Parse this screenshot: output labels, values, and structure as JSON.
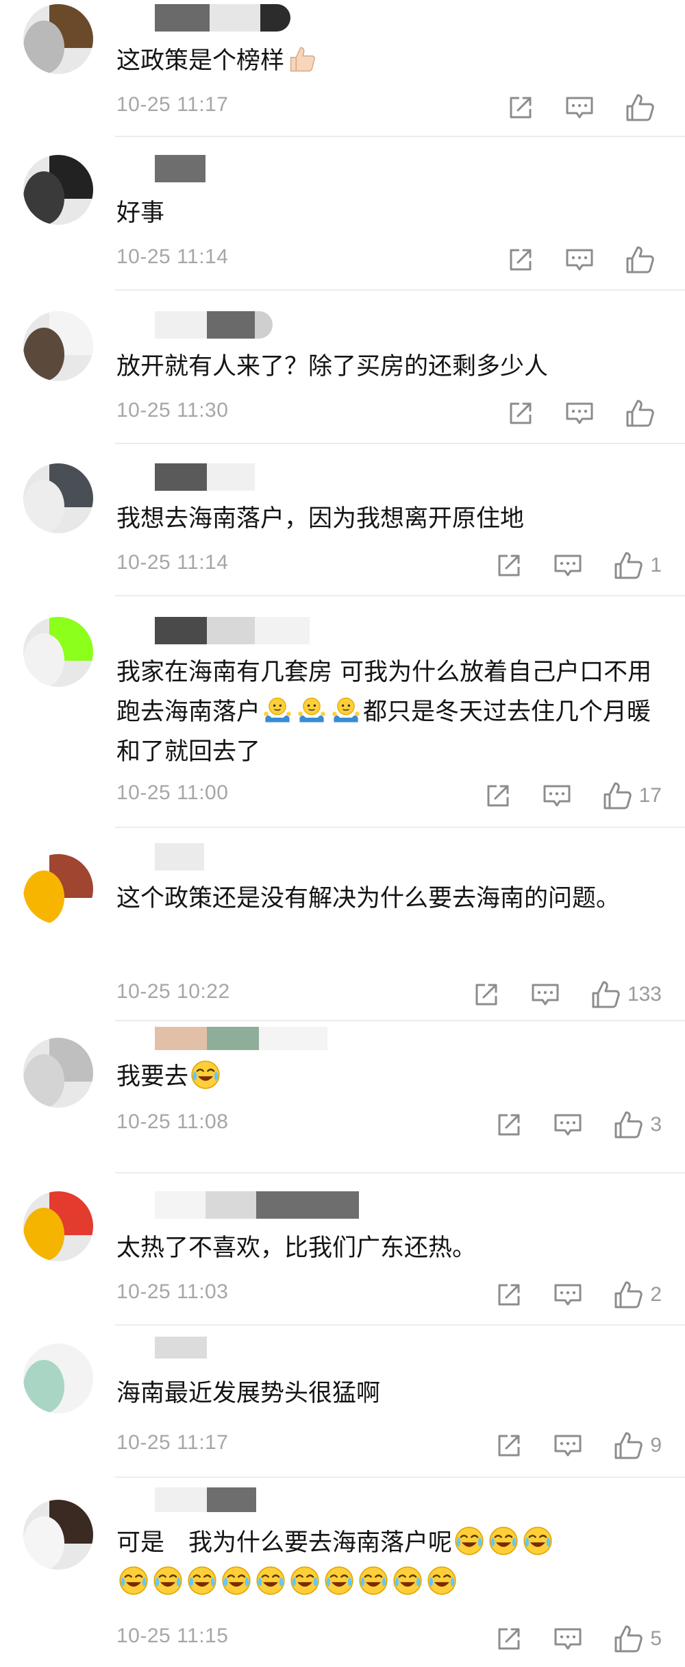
{
  "comments": [
    {
      "text": "这政策是个榜样",
      "time": "10-25 11:17",
      "likes": ""
    },
    {
      "text": "好事",
      "time": "10-25 11:14",
      "likes": ""
    },
    {
      "text": "放开就有人来了？除了买房的还剩多少人",
      "time": "10-25 11:30",
      "likes": ""
    },
    {
      "text": "我想去海南落户，因为我想离开原住地",
      "time": "10-25 11:14",
      "likes": "1"
    },
    {
      "text_a": "我家在海南有几套房 可我为什么放着自己户口不用跑去海南落户",
      "text_b": "都只是冬天过去住几个月暖和了就回去了",
      "time": "10-25 11:00",
      "likes": "17"
    },
    {
      "text": "这个政策还是没有解决为什么要去海南的问题。",
      "time": "10-25 10:22",
      "likes": "133"
    },
    {
      "text": "我要去",
      "time": "10-25 11:08",
      "likes": "3"
    },
    {
      "text": "太热了不喜欢，比我们广东还热。",
      "time": "10-25 11:03",
      "likes": "2"
    },
    {
      "text": "海南最近发展势头很猛啊",
      "time": "10-25 11:17",
      "likes": "9"
    },
    {
      "text": "可是　我为什么要去海南落户呢",
      "time": "10-25 11:15",
      "likes": "5"
    }
  ],
  "colors": {
    "time": "#a6a6a6",
    "text": "#141414",
    "icon": "#8c8c8c",
    "divider": "#ececec"
  },
  "icons": [
    "share-icon",
    "reply-icon",
    "thumbs-up-icon",
    "thumbs-up-emoji",
    "shrug-emoji",
    "laughing-crying-emoji"
  ]
}
